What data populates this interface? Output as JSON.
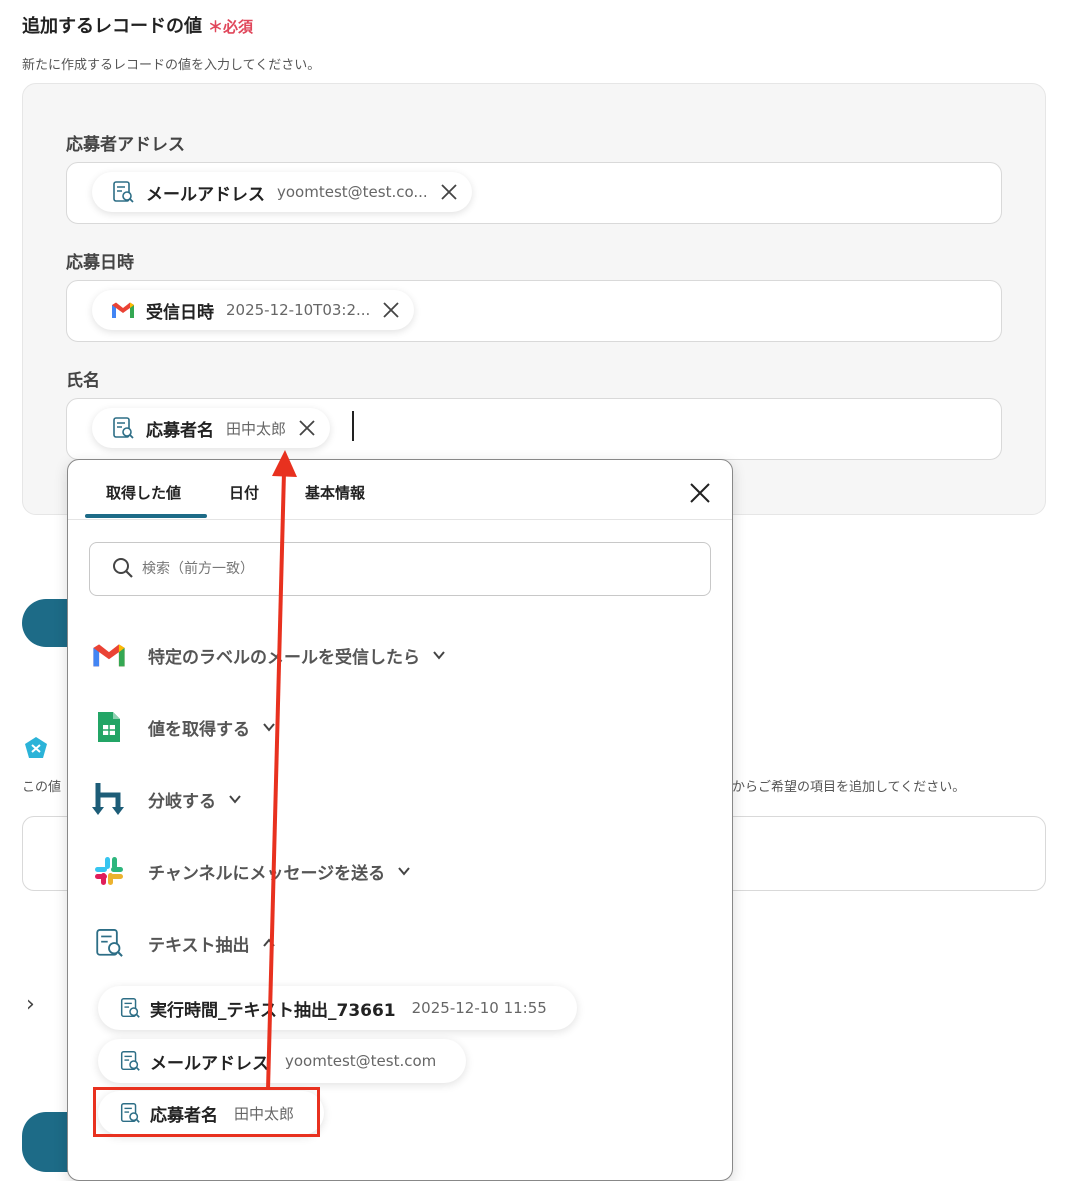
{
  "section": {
    "title": "追加するレコードの値",
    "required_mark": "＊必須",
    "description": "新たに作成するレコードの値を入力してください。"
  },
  "fields": [
    {
      "label": "応募者アドレス",
      "chip_name": "メールアドレス",
      "chip_value": "yoomtest@test.co...",
      "chip_icon": "text-extract-icon"
    },
    {
      "label": "応募日時",
      "chip_name": "受信日時",
      "chip_value": "2025-12-10T03:2...",
      "chip_icon": "gmail-icon"
    },
    {
      "label": "氏名",
      "chip_name": "応募者名",
      "chip_value": "田中太郎",
      "chip_icon": "text-extract-icon"
    }
  ],
  "background": {
    "text_left": "この値",
    "text_right": "からご希望の項目を追加してください。"
  },
  "popup": {
    "tabs": [
      "取得した値",
      "日付",
      "基本情報"
    ],
    "active_tab": "取得した値",
    "search_placeholder": "検索（前方一致）",
    "steps": [
      {
        "label": "特定のラベルのメールを受信したら",
        "icon": "gmail-icon",
        "expanded": false
      },
      {
        "label": "値を取得する",
        "icon": "google-sheets-icon",
        "expanded": false
      },
      {
        "label": "分岐する",
        "icon": "branch-icon",
        "expanded": false
      },
      {
        "label": "チャンネルにメッセージを送る",
        "icon": "slack-icon",
        "expanded": false
      },
      {
        "label": "テキスト抽出",
        "icon": "text-extract-icon",
        "expanded": true
      }
    ],
    "outputs": [
      {
        "name": "実行時間_テキスト抽出_73661",
        "value": "2025-12-10 11:55"
      },
      {
        "name": "メールアドレス",
        "value": "yoomtest@test.com"
      },
      {
        "name": "応募者名",
        "value": "田中太郎"
      }
    ]
  },
  "colors": {
    "accent": "#1d6b87",
    "required": "#e0475b",
    "annotation": "#e8311f"
  }
}
